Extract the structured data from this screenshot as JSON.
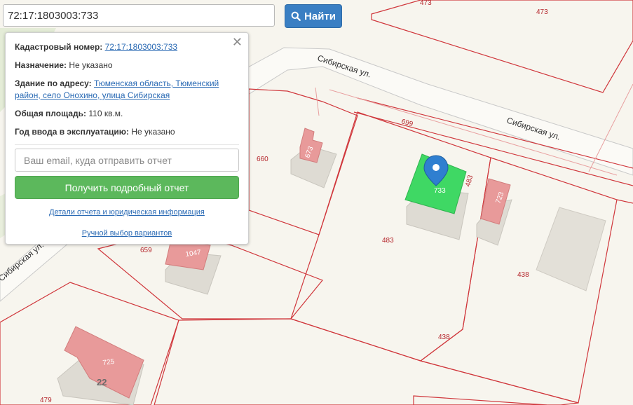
{
  "search": {
    "value": "72:17:1803003:733",
    "button_label": "Найти"
  },
  "popup": {
    "cadastral_label": "Кадастровый номер:",
    "cadastral_value": "72:17:1803003:733",
    "purpose_label": "Назначение:",
    "purpose_value": "Не указано",
    "address_label": "Здание по адресу:",
    "address_value": "Тюменская область, Тюменский район, село Онохино, улица Сибирская",
    "area_label": "Общая площадь:",
    "area_value": "110 кв.м.",
    "year_label": "Год ввода в эксплуатацию:",
    "year_value": "Не указано",
    "email_placeholder": "Ваш email, куда отправить отчет",
    "get_report_label": "Получить подробный отчет",
    "details_link": "Детали отчета и юридическая информация",
    "manual_link": "Ручной выбор вариантов",
    "close_symbol": "✕"
  },
  "map": {
    "streets": [
      "Сибирская ул.",
      "Сибирская ул.",
      "Сибирская ул."
    ],
    "parcel_labels": [
      "473",
      "473",
      "699",
      "660",
      "483",
      "483",
      "659",
      "438",
      "438",
      "479"
    ],
    "building_labels": [
      "673",
      "733",
      "723",
      "1047",
      "725"
    ],
    "house_number": "22",
    "colors": {
      "parcel_line": "#d0373c",
      "selected_building": "#3fd864",
      "building_roof": "#e89a9a",
      "marker": "#2f7fd0"
    }
  }
}
